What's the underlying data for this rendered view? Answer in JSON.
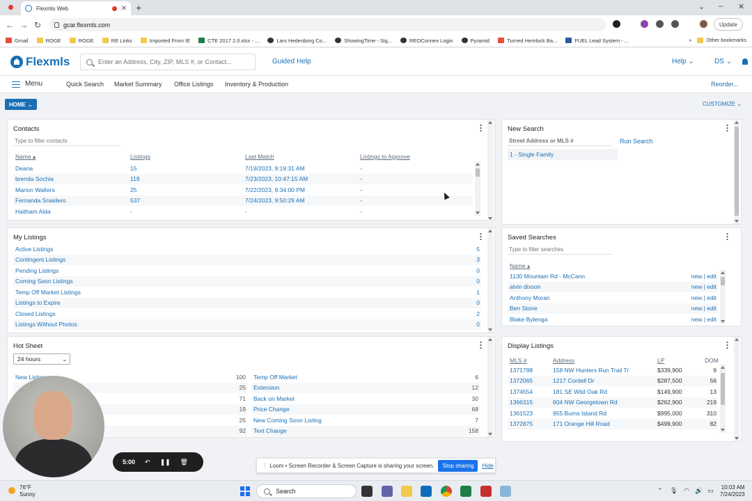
{
  "browser": {
    "tab_title": "Flexmls Web",
    "url": "gcar.flexmls.com",
    "update_label": "Update",
    "bookmarks": [
      "Gmail",
      "ROGE",
      "ROGE",
      "RE Links",
      "Imported From IE",
      "CTE 2017 2.0.xlsx - ...",
      "Lars Hedenborg Co...",
      "ShowingTime - Sig...",
      "REOConnex Login",
      "Pyramid",
      "Turned Hemlock Ba...",
      "FUEL Lead System - ..."
    ],
    "other_bookmarks": "Other bookmarks"
  },
  "header": {
    "logo": "Flexmls",
    "search_placeholder": "Enter an Address, City, ZIP, MLS #, or Contact...",
    "guided_help": "Guided Help",
    "help": "Help",
    "user": "DS"
  },
  "menubar": {
    "menu": "Menu",
    "items": [
      "Quick Search",
      "Market Summary",
      "Office Listings",
      "Inventory & Production"
    ],
    "reorder": "Reorder..."
  },
  "subbar": {
    "home": "HOME",
    "customize": "CUSTOMIZE"
  },
  "contacts": {
    "title": "Contacts",
    "filter_placeholder": "Type to filter contacts",
    "columns": [
      "Name",
      "Listings",
      "Last Match",
      "Listings to Approve"
    ],
    "rows": [
      {
        "name": "Deana",
        "listings": "15",
        "last_match": "7/19/2023, 9:19:31 AM",
        "approve": "-"
      },
      {
        "name": "brenda Sochia",
        "listings": "119",
        "last_match": "7/23/2023, 10:47:15 AM",
        "approve": "-"
      },
      {
        "name": "Marion Walters",
        "listings": "25",
        "last_match": "7/22/2023, 9:34:00 PM",
        "approve": "-"
      },
      {
        "name": "Fernanda Snaidero",
        "listings": "537",
        "last_match": "7/24/2023, 9:50:29 AM",
        "approve": "-"
      },
      {
        "name": "Haitham Alda",
        "listings": "-",
        "last_match": "-",
        "approve": "-"
      }
    ]
  },
  "new_search": {
    "title": "New Search",
    "input_placeholder": "Street Address or MLS #",
    "run": "Run Search",
    "option": "1 - Single Family"
  },
  "my_listings": {
    "title": "My Listings",
    "rows": [
      {
        "label": "Active Listings",
        "count": "5"
      },
      {
        "label": "Contingent Listings",
        "count": "3"
      },
      {
        "label": "Pending Listings",
        "count": "0"
      },
      {
        "label": "Coming Soon Listings",
        "count": "0"
      },
      {
        "label": "Temp Off Market Listings",
        "count": "1"
      },
      {
        "label": "Listings to Expire",
        "count": "0"
      },
      {
        "label": "Closed Listings",
        "count": "2"
      },
      {
        "label": "Listings Without Photos",
        "count": "0"
      }
    ]
  },
  "saved_searches": {
    "title": "Saved Searches",
    "filter_placeholder": "Type to filter searches",
    "column": "Name",
    "actions": "new | edit",
    "rows": [
      "1130 Mountain Rd - McCann",
      "alvin dixson",
      "Anthony Moran",
      "Ben Stone",
      "Blake Bylenga"
    ]
  },
  "hot_sheet": {
    "title": "Hot Sheet",
    "period": "24 hours",
    "left": [
      {
        "label": "New Listings",
        "count": "100"
      },
      {
        "label": "",
        "count": "25"
      },
      {
        "label": "",
        "count": "71"
      },
      {
        "label": "",
        "count": "19"
      },
      {
        "label": "",
        "count": "25"
      },
      {
        "label": "",
        "count": "92"
      }
    ],
    "right": [
      {
        "label": "Temp Off Market",
        "count": "6"
      },
      {
        "label": "Extension",
        "count": "12"
      },
      {
        "label": "Back on Market",
        "count": "30"
      },
      {
        "label": "Price Change",
        "count": "68"
      },
      {
        "label": "New Coming Soon Listing",
        "count": "7"
      },
      {
        "label": "Text Change",
        "count": "158"
      }
    ]
  },
  "display_listings": {
    "title": "Display Listings",
    "columns": [
      "MLS #",
      "Address",
      "LP",
      "DOM"
    ],
    "rows": [
      {
        "mls": "1371798",
        "address": "158 NW Hunters Run Trail Tr",
        "lp": "$339,900",
        "dom": "9"
      },
      {
        "mls": "1372065",
        "address": "1217 Cordell Dr",
        "lp": "$287,500",
        "dom": "56"
      },
      {
        "mls": "1374554",
        "address": "181 SE Wild Oak Rd",
        "lp": "$149,900",
        "dom": "13"
      },
      {
        "mls": "1366315",
        "address": "604 NW Georgetown Rd",
        "lp": "$262,900",
        "dom": "219"
      },
      {
        "mls": "1361523",
        "address": "955 Burns Island Rd",
        "lp": "$995,000",
        "dom": "310"
      },
      {
        "mls": "1372875",
        "address": "171 Orange Hill Road",
        "lp": "$499,900",
        "dom": "82"
      }
    ]
  },
  "recorder": {
    "timer": "5:00"
  },
  "loom": {
    "message": "Loom • Screen Recorder & Screen Capture is sharing your screen.",
    "stop": "Stop sharing",
    "hide": "Hide"
  },
  "taskbar": {
    "temp": "76°F",
    "condition": "Sunny",
    "search": "Search",
    "time": "10:03 AM",
    "date": "7/24/2023"
  }
}
